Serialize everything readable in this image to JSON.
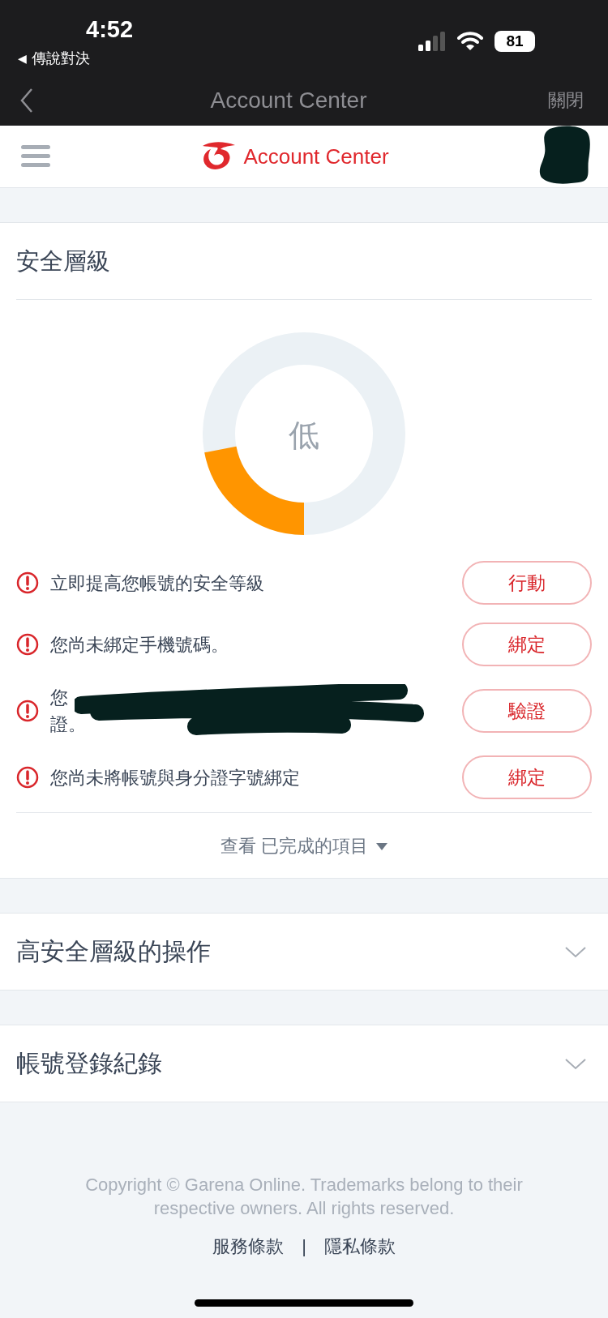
{
  "status_bar": {
    "time": "4:52",
    "back_icon": "◀",
    "back_app": "傳說對決",
    "battery": "81"
  },
  "nav": {
    "title": "Account Center",
    "close": "關閉"
  },
  "header": {
    "title": "Account Center",
    "avatar_redacted": true
  },
  "security": {
    "title": "安全層級",
    "gauge": {
      "level": 0.22,
      "label": "低"
    },
    "items": [
      {
        "text": "立即提高您帳號的安全等級",
        "action": "行動",
        "redacted": false
      },
      {
        "text": "您尚未綁定手機號碼。",
        "action": "綁定",
        "redacted": false
      },
      {
        "text": "您",
        "text_2": "證。",
        "action": "驗證",
        "redacted": true
      },
      {
        "text": "您尚未將帳號與身分證字號綁定",
        "action": "綁定",
        "redacted": false
      }
    ],
    "show_completed": {
      "label": "查看 已完成的項目",
      "expanded": false
    }
  },
  "sections": [
    {
      "title": "高安全層級的操作",
      "expanded": false
    },
    {
      "title": "帳號登錄紀錄",
      "expanded": false
    }
  ],
  "footer": {
    "copyright": "Copyright © Garena Online. Trademarks belong to their respective owners. All rights reserved.",
    "links": [
      "服務條款",
      "隱私條款"
    ],
    "separator": "|"
  }
}
